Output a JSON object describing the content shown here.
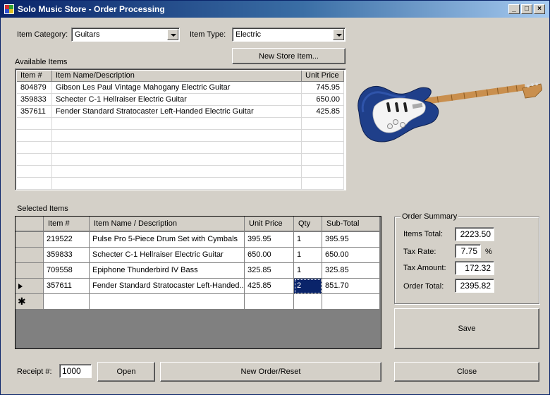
{
  "window": {
    "title": "Solo Music Store - Order Processing"
  },
  "filters": {
    "category_label": "Item Category:",
    "category_value": "Guitars",
    "type_label": "Item Type:",
    "type_value": "Electric"
  },
  "new_store_item_label": "New Store Item...",
  "available": {
    "label": "Available Items",
    "columns": [
      "Item #",
      "Item Name/Description",
      "Unit Price"
    ],
    "rows": [
      [
        "804879",
        "Gibson Les Paul Vintage Mahogany Electric Guitar",
        "745.95"
      ],
      [
        "359833",
        "Schecter C-1 Hellraiser Electric Guitar",
        "650.00"
      ],
      [
        "357611",
        "Fender Standard Stratocaster Left-Handed Electric Guitar",
        "425.85"
      ]
    ]
  },
  "selected": {
    "label": "Selected Items",
    "columns": [
      "Item #",
      "Item Name / Description",
      "Unit Price",
      "Qty",
      "Sub-Total"
    ],
    "rows": [
      [
        "219522",
        "Pulse Pro 5-Piece Drum Set with Cymbals",
        "395.95",
        "1",
        "395.95"
      ],
      [
        "359833",
        "Schecter C-1 Hellraiser Electric Guitar",
        "650.00",
        "1",
        "650.00"
      ],
      [
        "709558",
        "Epiphone Thunderbird IV Bass",
        "325.85",
        "1",
        "325.85"
      ],
      [
        "357611",
        "Fender Standard Stratocaster Left-Handed...",
        "425.85",
        "2",
        "851.70"
      ]
    ]
  },
  "summary": {
    "title": "Order Summary",
    "items_total_label": "Items Total:",
    "items_total": "2223.50",
    "tax_rate_label": "Tax Rate:",
    "tax_rate": "7.75",
    "tax_rate_unit": "%",
    "tax_amount_label": "Tax Amount:",
    "tax_amount": "172.32",
    "order_total_label": "Order Total:",
    "order_total": "2395.82"
  },
  "receipt": {
    "label": "Receipt #:",
    "value": "1000"
  },
  "buttons": {
    "open": "Open",
    "new_order": "New Order/Reset",
    "save": "Save",
    "close": "Close"
  }
}
